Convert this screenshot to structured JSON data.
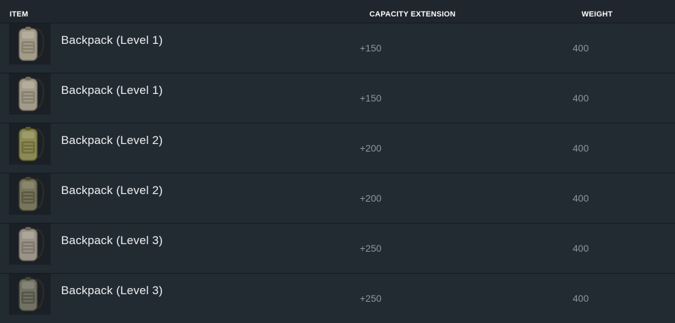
{
  "header": {
    "item": "ITEM",
    "capacity": "CAPACITY EXTENSION",
    "weight": "WEIGHT"
  },
  "rows": [
    {
      "name": "Backpack (Level 1)",
      "capacity": "+150",
      "weight": "400",
      "icon": "backpack-icon",
      "color": "#a39c8b"
    },
    {
      "name": "Backpack (Level 1)",
      "capacity": "+150",
      "weight": "400",
      "icon": "backpack-icon",
      "color": "#a39c8b"
    },
    {
      "name": "Backpack (Level 2)",
      "capacity": "+200",
      "weight": "400",
      "icon": "backpack-icon",
      "color": "#8b8a57"
    },
    {
      "name": "Backpack (Level 2)",
      "capacity": "+200",
      "weight": "400",
      "icon": "backpack-icon",
      "color": "#77755d"
    },
    {
      "name": "Backpack (Level 3)",
      "capacity": "+250",
      "weight": "400",
      "icon": "backpack-icon",
      "color": "#9a9488"
    },
    {
      "name": "Backpack (Level 3)",
      "capacity": "+250",
      "weight": "400",
      "icon": "backpack-icon",
      "color": "#727264"
    }
  ]
}
